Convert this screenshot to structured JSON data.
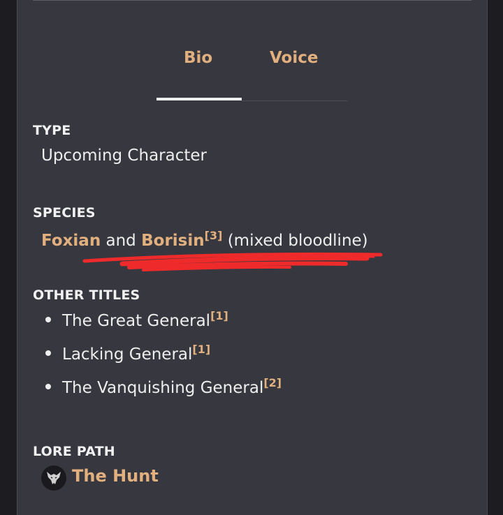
{
  "tabs": [
    {
      "label": "Bio",
      "active": true
    },
    {
      "label": "Voice",
      "active": false
    }
  ],
  "type": {
    "label": "TYPE",
    "value": "Upcoming Character"
  },
  "species": {
    "label": "SPECIES",
    "link1": "Foxian",
    "connector": " and ",
    "link2": "Borisin",
    "ref": "[3]",
    "suffix": " (mixed bloodline)"
  },
  "other_titles": {
    "label": "OTHER TITLES",
    "items": [
      {
        "text": "The Great General",
        "ref": "[1]"
      },
      {
        "text": "Lacking General",
        "ref": "[1]"
      },
      {
        "text": "The Vanquishing General",
        "ref": "[2]"
      }
    ]
  },
  "lore_path": {
    "label": "LORE PATH",
    "value": "The Hunt",
    "icon": "wolf-head-icon"
  },
  "colors": {
    "accent": "#e2b07e",
    "panel": "#37373f",
    "background": "#1c1c21",
    "scribble": "#ef2a2a"
  }
}
